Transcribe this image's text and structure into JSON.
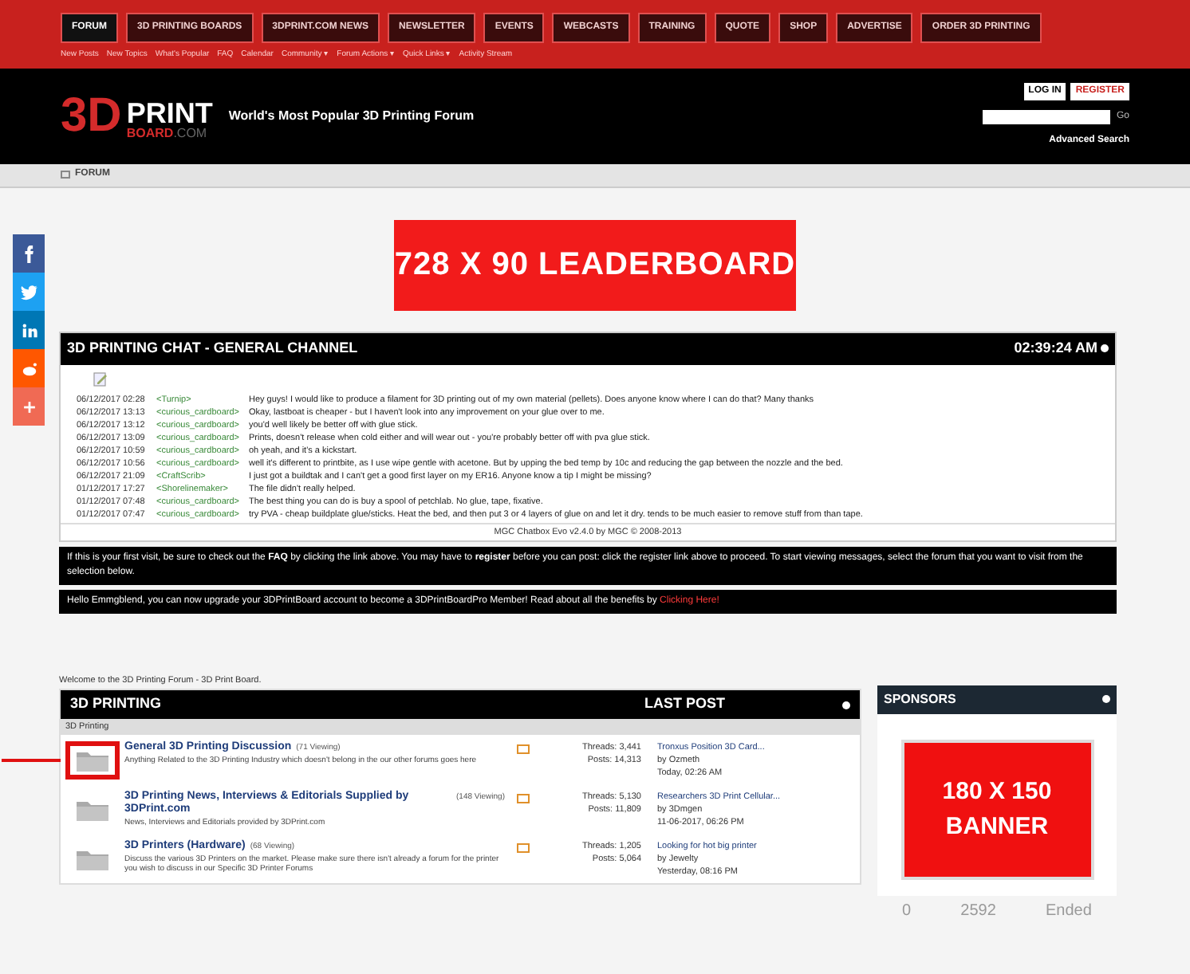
{
  "nav": {
    "tabs": [
      {
        "label": "FORUM",
        "selected": true
      },
      {
        "label": "3D PRINTING BOARDS",
        "selected": false
      },
      {
        "label": "3DPRINT.COM NEWS",
        "selected": false
      },
      {
        "label": "NEWSLETTER",
        "selected": false
      },
      {
        "label": "EVENTS",
        "selected": false
      },
      {
        "label": "WEBCASTS",
        "selected": false
      },
      {
        "label": "TRAINING",
        "selected": false
      },
      {
        "label": "QUOTE",
        "selected": false
      },
      {
        "label": "SHOP",
        "selected": false
      },
      {
        "label": "ADVERTISE",
        "selected": false
      },
      {
        "label": "ORDER 3D PRINTING",
        "selected": false
      }
    ],
    "sublinks": [
      "New Posts",
      "New Topics",
      "What's Popular",
      "FAQ",
      "Calendar",
      "Community ▾",
      "Forum Actions ▾",
      "Quick Links ▾",
      "Activity Stream"
    ]
  },
  "header": {
    "logo_main": "3D",
    "logo_print": "PRINT",
    "logo_board": "BOARD",
    "logo_com": ".COM",
    "tagline": "World's Most Popular 3D Printing Forum",
    "login": "LOG IN",
    "register": "REGISTER",
    "search_button": "Go",
    "advanced_search": "Advanced Search"
  },
  "breadcrumb": "FORUM",
  "leaderboard": "728 X 90 LEADERBOARD",
  "chat": {
    "title": "3D PRINTING CHAT - GENERAL CHANNEL",
    "time": "02:39:24 AM",
    "footer": "MGC Chatbox Evo v2.4.0 by MGC © 2008-2013",
    "messages": [
      {
        "date": "06/12/2017 02:28",
        "user": "<Turnip>",
        "text": "Hey guys! I would like to produce a filament for 3D printing out of my own material (pellets). Does anyone know where I can do that? Many thanks"
      },
      {
        "date": "06/12/2017 13:13",
        "user": "<curious_cardboard>",
        "text": "Okay, lastboat is cheaper - but I haven't look into any improvement on your glue over to me."
      },
      {
        "date": "06/12/2017 13:12",
        "user": "<curious_cardboard>",
        "text": "you'd well likely be better off with glue stick."
      },
      {
        "date": "06/12/2017 13:09",
        "user": "<curious_cardboard>",
        "text": "Prints, doesn't release when cold either and will wear out - you're probably better off with pva glue stick."
      },
      {
        "date": "06/12/2017 10:59",
        "user": "<curious_cardboard>",
        "text": "oh yeah, and it's a kickstart."
      },
      {
        "date": "06/12/2017 10:56",
        "user": "<curious_cardboard>",
        "text": "well it's different to printbite, as I use wipe gentle with acetone. But by upping the bed temp by 10c and reducing the gap between the nozzle and the bed."
      },
      {
        "date": "06/12/2017 21:09",
        "user": "<CraftScrib>",
        "text": "I just got a buildtak and I can't get a good first layer on my ER16. Anyone know a tip I might be missing?"
      },
      {
        "date": "01/12/2017 17:27",
        "user": "<Shorelinemaker>",
        "text": "The file didn't really helped."
      },
      {
        "date": "01/12/2017 07:48",
        "user": "<curious_cardboard>",
        "text": "The best thing you can do is buy a spool of petchlab. No glue, tape, fixative."
      },
      {
        "date": "01/12/2017 07:47",
        "user": "<curious_cardboard>",
        "text": "try PVA - cheap buildplate glue/sticks. Heat the bed, and then put 3 or 4 layers of glue on and let it dry. tends to be much easier to remove stuff from than tape."
      }
    ]
  },
  "notices": [
    {
      "text": "If this is your first visit, be sure to check out the **FAQ** by clicking the link above. You may have to **register** before you can post: click the register link above to proceed. To start viewing messages, select the forum that you want to visit from the selection below."
    },
    {
      "text": "Hello Emmgblend, you can now upgrade your 3DPrintBoard account to become a 3DPrintBoardPro Member! Read about all the benefits by",
      "link": "Clicking Here!"
    }
  ],
  "welcome": "Welcome to the 3D Printing Forum - 3D Print Board.",
  "forum_table": {
    "title": "3D PRINTING",
    "last_post_header": "LAST POST",
    "section": "3D Printing",
    "forums": [
      {
        "title": "General 3D Printing Discussion",
        "viewing": "(71 Viewing)",
        "description": "Anything Related to the 3D Printing Industry which doesn't belong in the our other forums goes here",
        "threads": "Threads: 3,441",
        "posts": "Posts: 14,313",
        "last_title": "Tronxus Position 3D Card...",
        "last_by": "by Ozmeth",
        "last_date": "Today, 02:26 AM",
        "highlighted": true
      },
      {
        "title": "3D Printing News, Interviews & Editorials Supplied by 3DPrint.com",
        "viewing": "(148 Viewing)",
        "description": "News, Interviews and Editorials provided by 3DPrint.com",
        "threads": "Threads: 5,130",
        "posts": "Posts: 11,809",
        "last_title": "Researchers 3D Print Cellular...",
        "last_by": "by 3Dmgen",
        "last_date": "11-06-2017, 06:26 PM",
        "highlighted": false
      },
      {
        "title": "3D Printers (Hardware)",
        "viewing": "(68 Viewing)",
        "description": "Discuss the various 3D Printers on the market. Please make sure there isn't already a forum for the printer you wish to discuss in our Specific 3D Printer Forums",
        "threads": "Threads: 1,205",
        "posts": "Posts: 5,064",
        "last_title": "Looking for hot big printer",
        "last_by": "by Jewelty",
        "last_date": "Yesterday, 08:16 PM",
        "highlighted": false
      }
    ]
  },
  "sponsors": {
    "title": "SPONSORS",
    "banner_line1": "180 X 150",
    "banner_line2": "BANNER",
    "stats": [
      "0",
      "2592",
      "Ended"
    ]
  },
  "social": [
    {
      "kind": "facebook",
      "color": "#3b5998"
    },
    {
      "kind": "twitter",
      "color": "#1da1f2"
    },
    {
      "kind": "linkedin",
      "color": "#0077b5"
    },
    {
      "kind": "reddit",
      "color": "#ff5700"
    },
    {
      "kind": "more",
      "color": "#f06a54"
    }
  ]
}
